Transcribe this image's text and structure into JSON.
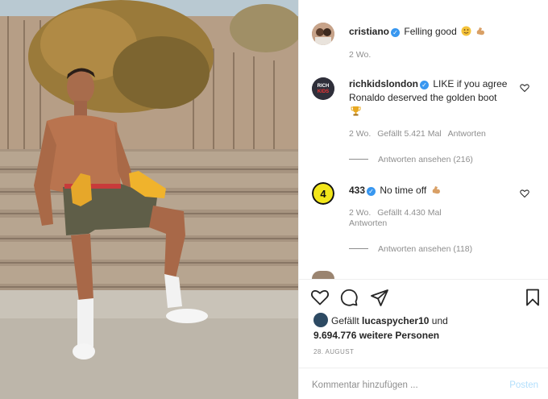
{
  "caption": {
    "username": "cristiano",
    "text": "Felling good",
    "time": "2 Wo."
  },
  "comments": [
    {
      "username": "richkidslondon",
      "avatar_text": "RICH KIDS",
      "text": "LIKE if you agree Ronaldo deserved the golden boot",
      "time": "2 Wo.",
      "likes": "Gefällt 5.421 Mal",
      "reply": "Antworten",
      "view_replies": "Antworten ansehen (216)"
    },
    {
      "username": "433",
      "avatar_text": "4",
      "text": "No time off",
      "time": "2 Wo.",
      "likes": "Gefällt 4.430 Mal",
      "reply": "Antworten",
      "view_replies": "Antworten ansehen (118)"
    }
  ],
  "likes": {
    "prefix": "Gefällt",
    "user": "lucaspycher10",
    "middle": "und",
    "count": "9.694.776 weitere Personen"
  },
  "date": "28. AUGUST",
  "comment_input": {
    "placeholder": "Kommentar hinzufügen ..."
  },
  "post_button": "Posten",
  "colors": {
    "verified": "#3897f0",
    "post_disabled": "#b2dffc",
    "meta": "#8e8e8e"
  }
}
